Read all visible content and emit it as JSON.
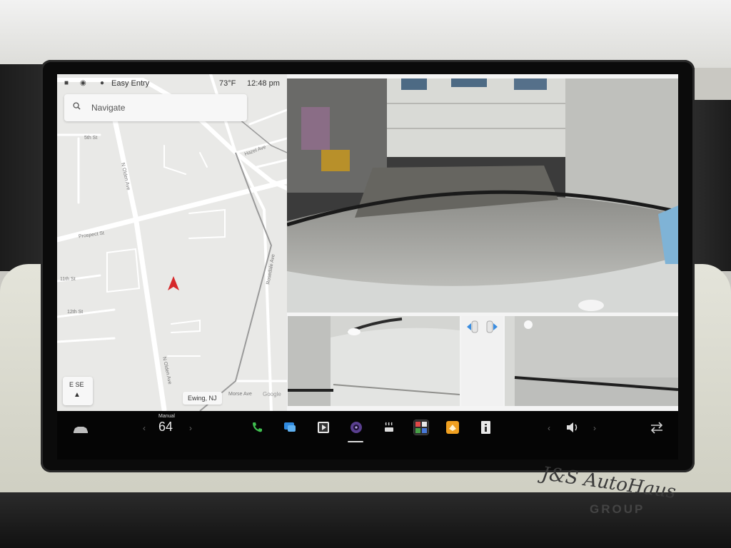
{
  "status_bar": {
    "profile_name": "Easy Entry",
    "temperature": "73°F",
    "time": "12:48 pm"
  },
  "search": {
    "placeholder": "Navigate"
  },
  "map": {
    "streets": {
      "fifth": "5th St",
      "hazel": "Hazel Ave",
      "prospect": "Prospect St",
      "eleventh": "11th St",
      "twelfth": "12th St",
      "olden_top": "N Olden Ave",
      "olden_bottom": "N Olden Ave",
      "rosedale": "Rosedale Ave",
      "morse": "Morse Ave"
    },
    "location": "Ewing, NJ",
    "attribution": "Google",
    "compass_heading": "E SE"
  },
  "taskbar": {
    "speed_label": "Manual",
    "speed_value": "64",
    "apps": [
      "phone-icon",
      "messages-icon",
      "media-icon",
      "camera-icon",
      "seat-heat-icon",
      "app-launcher-icon",
      "toybox-icon",
      "manual-icon"
    ]
  },
  "colors": {
    "nav_arrow": "#d6282b",
    "taskbar": "#050505",
    "map_background": "#e9e9e7"
  },
  "watermark": {
    "line1": "J&S AutoHaus",
    "line2": "GROUP"
  }
}
